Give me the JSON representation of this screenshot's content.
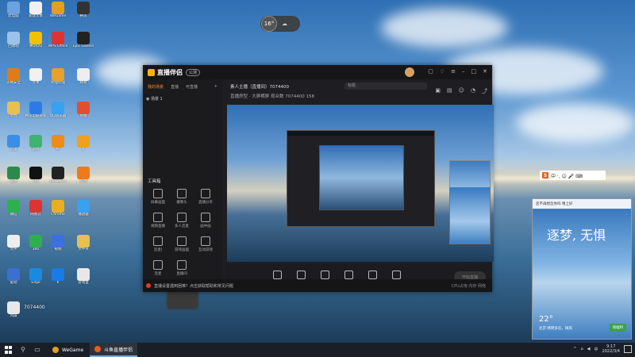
{
  "weather_widget": {
    "temp": "16°"
  },
  "app": {
    "logo": "直播伴侣",
    "version": "公测",
    "left_tabs": [
      "我的场景",
      "直播",
      "可直播"
    ],
    "scene_name": "场景 1",
    "streamer_line": "素人主播（直播间）7074400",
    "topic_placeholder": "标题",
    "info_line": "直播房型 · 大屏横屏  观众数 7074400  158",
    "tools_title": "工具箱",
    "tools": [
      "屏幕画面",
      "摄像头",
      "直播分享",
      "视频直播",
      "多人连麦",
      "画中画",
      "连麦Ⅰ",
      "游戏画面",
      "互动游戏",
      "连麦",
      "直播间"
    ],
    "bottom_buttons": [
      "直播屏幕",
      "摄像头",
      "手机投屏",
      "录屏",
      "麦克风",
      "扬声器"
    ],
    "start_live": "开始直播",
    "status_line": "直播设置遇到困难？点击获取帮助和常见问题",
    "status_right": "CPU占用  内存  网络"
  },
  "ime": {
    "s": "S",
    "label": "中 ·, ☺ 🎤 ⌨"
  },
  "weather_panel": {
    "header": "您不再想念你吗    晴上好",
    "slogan": "逐梦, 无惧",
    "temp": "22°",
    "desc": "北京 晴转多云，微风",
    "button": "领福利"
  },
  "desktop_icons": [
    {
      "label": "此电脑",
      "color": "#6aa3e0"
    },
    {
      "label": "新建文本",
      "color": "#f0f0f0"
    },
    {
      "label": "WeGame",
      "color": "#e0a020"
    },
    {
      "label": "腾讯",
      "color": "#333"
    },
    {
      "label": "回收站",
      "color": "#9bc3ea"
    },
    {
      "label": "腾讯QQ",
      "color": "#f2c200"
    },
    {
      "label": "WPS Office",
      "color": "#d33"
    },
    {
      "label": "Epic Games",
      "color": "#222"
    },
    {
      "label": "火绒安全",
      "color": "#e07b1a"
    },
    {
      "label": "文本",
      "color": "#f0f0f0"
    },
    {
      "label": "哔哩哔哩",
      "color": "#e8a030"
    },
    {
      "label": "网易",
      "color": "#eee"
    },
    {
      "label": "文档",
      "color": "#e8c050"
    },
    {
      "label": "腾讯电脑管家",
      "color": "#2c7be5"
    },
    {
      "label": "QQ浏览器",
      "color": "#3aa0f0"
    },
    {
      "label": "地图",
      "color": "#e05030"
    },
    {
      "label": "迅雷",
      "color": "#3a8ee6"
    },
    {
      "label": "游戏",
      "color": "#3fb36f"
    },
    {
      "label": "XF",
      "color": "#f08a1a"
    },
    {
      "label": "V",
      "color": "#f0a020"
    },
    {
      "label": "设备",
      "color": "#2a8a4a"
    },
    {
      "label": "QQ",
      "color": "#111"
    },
    {
      "label": "WeGame",
      "color": "#222"
    },
    {
      "label": "应用",
      "color": "#f07a1a"
    },
    {
      "label": "微信",
      "color": "#2bb24a"
    },
    {
      "label": "网易云",
      "color": "#d33"
    },
    {
      "label": "Chrome",
      "color": "#e8b020"
    },
    {
      "label": "播放器",
      "color": "#3aa0f0"
    },
    {
      "label": "文件",
      "color": "#eee"
    },
    {
      "label": "360",
      "color": "#2fae4f"
    },
    {
      "label": "视频",
      "color": "#3c6fe0"
    },
    {
      "label": "文件夹",
      "color": "#e8c050"
    },
    {
      "label": "驱动",
      "color": "#3b6fd0"
    },
    {
      "label": "Edge",
      "color": "#1a8ae0"
    },
    {
      "label": "K",
      "color": "#1a7ae6"
    },
    {
      "label": "游戏盒",
      "color": "#e8e8e8"
    },
    {
      "label": "风扇",
      "color": "#e8e8e8"
    }
  ],
  "overlay_number": "7074400",
  "taskbar": {
    "apps": [
      "WeGame",
      "斗鱼直播伴侣"
    ],
    "time": "9:17",
    "date": "2022/3/4"
  }
}
